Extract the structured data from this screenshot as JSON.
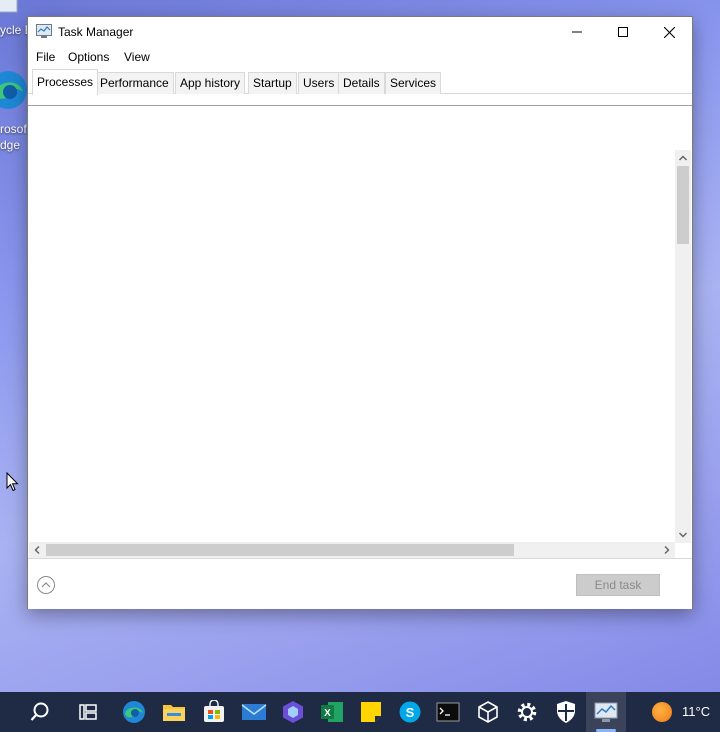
{
  "desktop": {
    "icons": [
      {
        "label": "ycle B"
      },
      {
        "label": "rosof"
      },
      {
        "label": "dge"
      }
    ]
  },
  "window": {
    "title": "Task Manager",
    "menu": [
      "File",
      "Options",
      "View"
    ],
    "tabs": [
      "Processes",
      "Performance",
      "App history",
      "Startup",
      "Users",
      "Details",
      "Services"
    ],
    "active_tab": "Processes",
    "end_task_label": "End task"
  },
  "taskbar": {
    "icons": [
      "search-icon",
      "task-view-icon",
      "edge-icon",
      "file-explorer-icon",
      "store-icon",
      "mail-icon",
      "clipchamp-icon",
      "excel-icon",
      "sticky-notes-icon",
      "skype-icon",
      "terminal-icon",
      "3d-viewer-icon",
      "settings-icon",
      "security-icon",
      "task-manager-icon"
    ],
    "weather_temp": "11°C"
  },
  "colors": {
    "taskbar_bg": "#1f2a44",
    "accent": "#8ab4f8"
  }
}
